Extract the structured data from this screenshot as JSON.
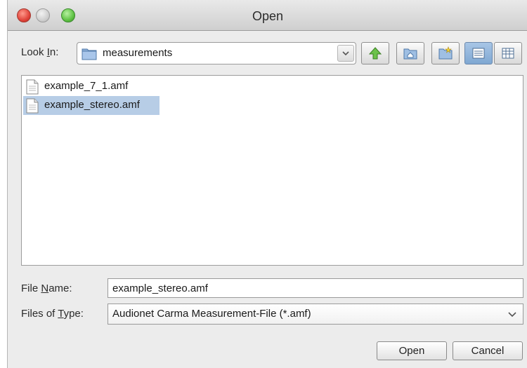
{
  "window": {
    "title": "Open"
  },
  "lookin": {
    "label_before": "Look ",
    "label_mnemonic": "I",
    "label_after": "n:",
    "value": "measurements"
  },
  "toolbar": {
    "icons": [
      "up-folder-icon",
      "home-icon",
      "new-folder-icon",
      "list-view-icon",
      "details-view-icon"
    ],
    "active_view": "list-view"
  },
  "files": [
    {
      "name": "example_7_1.amf",
      "selected": false
    },
    {
      "name": "example_stereo.amf",
      "selected": true
    }
  ],
  "filename": {
    "label_before": "File ",
    "label_mnemonic": "N",
    "label_after": "ame:",
    "value": "example_stereo.amf"
  },
  "filetype": {
    "label_before": "Files of ",
    "label_mnemonic": "T",
    "label_after": "ype:",
    "value": "Audionet Carma Measurement-File (*.amf)"
  },
  "buttons": {
    "open": "Open",
    "cancel": "Cancel"
  },
  "colors": {
    "selection": "#b7cde6",
    "active_toggle": "#8fb3da"
  }
}
